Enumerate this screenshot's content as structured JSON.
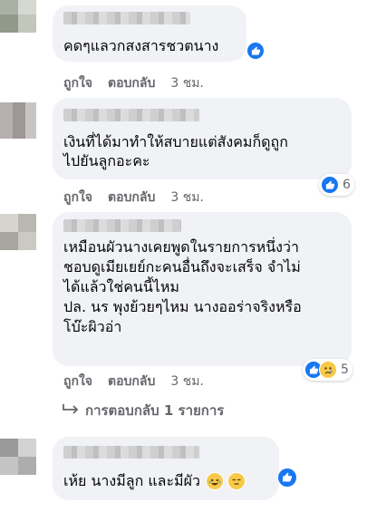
{
  "comments": [
    {
      "text": "คดๆแลวกสงสารชวตนาง",
      "actions": {
        "like": "ถูกใจ",
        "reply": "ตอบกลับ",
        "time": "3 ชม."
      }
    },
    {
      "text": "เงินที่ได้มาทำให้สบายแต่สังคมก็ดูถูก\nไปยันลูกอะคะ",
      "actions": {
        "like": "ถูกใจ",
        "reply": "ตอบกลับ",
        "time": "3 ชม."
      },
      "reaction_count": "6"
    },
    {
      "text": "เหมือนผัวนางเคยพูดในรายการหนึ่งว่า\nชอบดูเมียเยย์กะคนอื่นถึงจะเสร็จ จำไม่\nได้แล้วใช่คนนี้ไหม\nปล. นร พุงย้วยๆไหม นางออร่าจริงหรือ\nโบ๊ะผิวอ่า",
      "actions": {
        "like": "ถูกใจ",
        "reply": "ตอบกลับ",
        "time": "3 ชม."
      },
      "reaction_count": "5",
      "replies_link": "การตอบกลับ 1 รายการ"
    },
    {
      "text": "เห้ย นางมีลูก และมีผัว"
    }
  ],
  "icons": {
    "like": "thumbs-up-icon",
    "sad": "sad-emoji-icon",
    "laugh": "laughing-emoji-icon",
    "unamused": "unamused-emoji-icon",
    "reply_arrow": "reply-arrow-icon"
  },
  "colors": {
    "like_blue": "#1877f2",
    "bubble": "#f0f2f5",
    "meta_gray": "#65676b"
  }
}
